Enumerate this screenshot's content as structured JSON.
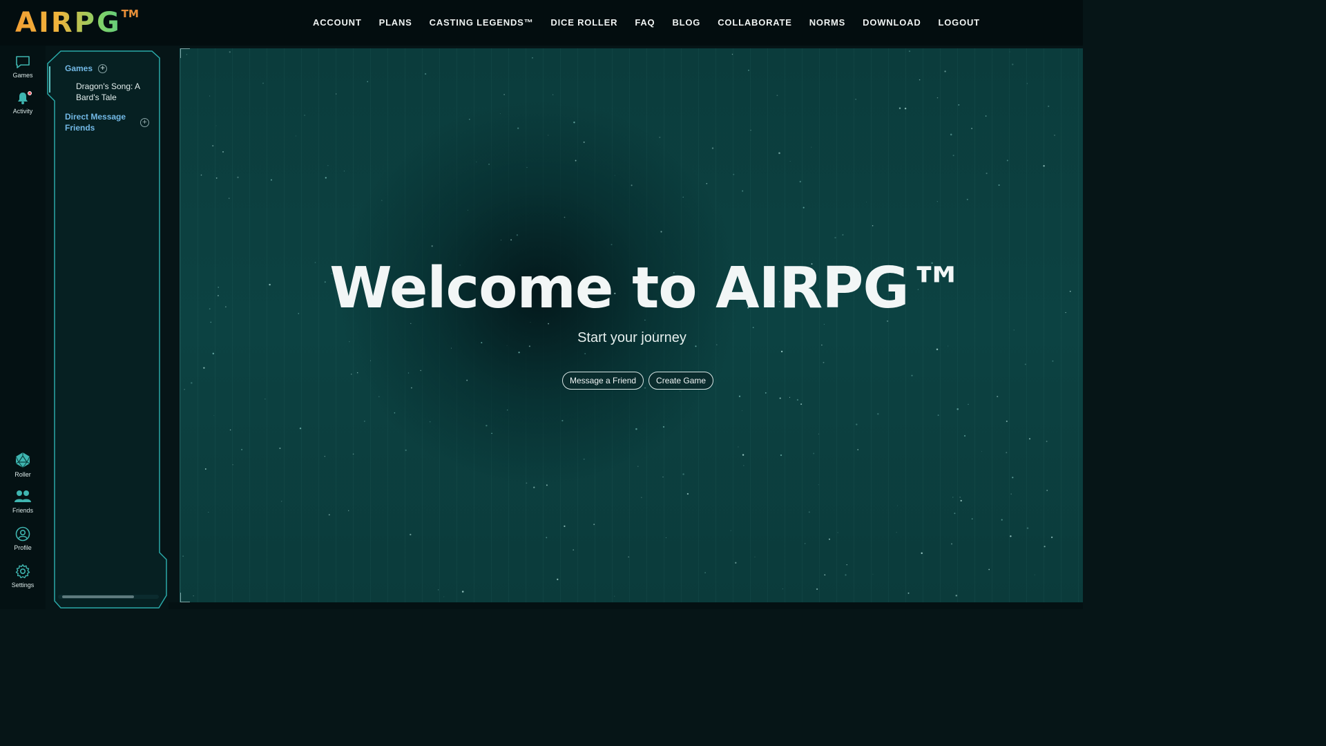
{
  "header": {
    "logo_text": "AIRPG",
    "logo_tm": "TM",
    "nav": [
      "ACCOUNT",
      "PLANS",
      "CASTING LEGENDS™",
      "DICE ROLLER",
      "FAQ",
      "BLOG",
      "COLLABORATE",
      "NORMS",
      "DOWNLOAD",
      "LOGOUT"
    ]
  },
  "rail": {
    "games": "Games",
    "activity": "Activity",
    "roller": "Roller",
    "friends": "Friends",
    "profile": "Profile",
    "settings": "Settings"
  },
  "sidebar": {
    "games_heading": "Games",
    "games": [
      "Dragon's Song: A Bard's Tale"
    ],
    "dm_heading": "Direct Message Friends",
    "add_symbol": "+"
  },
  "main": {
    "welcome": "Welcome to AIRPG™",
    "subtitle": "Start your journey",
    "message_friend_label": "Message a Friend",
    "create_game_label": "Create Game"
  },
  "colors": {
    "accent_blue": "#73b9e6",
    "teal_icon": "#3fb5b0",
    "panel_border": "#2aa9a8",
    "notification": "#ff5c6a",
    "logo_orange": "#f3a034",
    "logo_green": "#43c48f"
  }
}
